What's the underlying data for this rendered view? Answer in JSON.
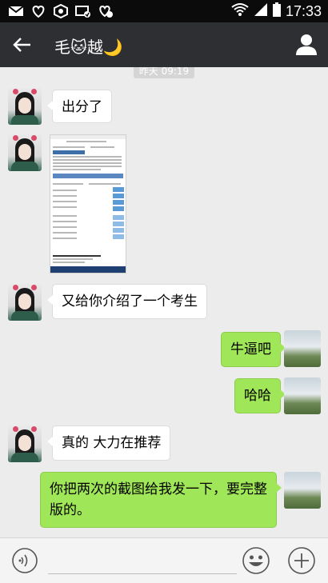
{
  "status_bar": {
    "time": "17:33",
    "left_icons": [
      "mail-icon",
      "notification-heart-icon",
      "settings-hex-icon",
      "mail-check-icon",
      "notification-check-icon"
    ],
    "right_icons": [
      "wifi-icon",
      "signal-icon",
      "battery-icon"
    ]
  },
  "header": {
    "title": "毛🐱越🌙",
    "back_icon": "back-arrow-icon",
    "profile_icon": "person-icon"
  },
  "chat": {
    "timestamp": "昨天 09:19",
    "messages": [
      {
        "side": "left",
        "type": "text",
        "text": "出分了"
      },
      {
        "side": "left",
        "type": "image",
        "text": ""
      },
      {
        "side": "left",
        "type": "text",
        "text": "又给你介绍了一个考生"
      },
      {
        "side": "right",
        "type": "text",
        "text": "牛逼吧"
      },
      {
        "side": "right",
        "type": "text",
        "text": "哈哈"
      },
      {
        "side": "left",
        "type": "text",
        "text": "真的 大力在推荐"
      },
      {
        "side": "right",
        "type": "text",
        "text": "你把两次的截图给我发一下，要完整版的。"
      }
    ]
  },
  "input_bar": {
    "voice_icon": "voice-icon",
    "emoji_icon": "emoji-icon",
    "plus_icon": "plus-icon"
  },
  "colors": {
    "background": "#ececec",
    "header": "#2e2f33",
    "status_bar": "#0b0b0b",
    "bubble_sent": "#9fe658",
    "bubble_received": "#ffffff"
  }
}
